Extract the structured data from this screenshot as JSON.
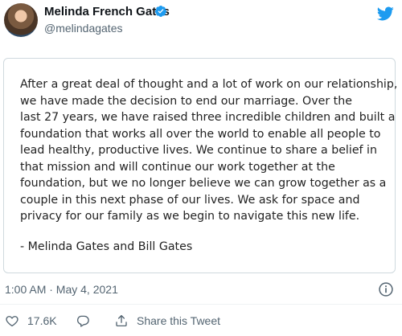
{
  "tweet": {
    "author": {
      "name": "Melinda French Gates",
      "handle": "@melindagates"
    },
    "statement_lines": [
      "After a great deal of thought and a lot of work on our relationship,",
      "we have made the decision to end our marriage. Over the",
      "last 27 years, we have raised three incredible children and built a",
      "foundation that works all over the world to enable all people to",
      "lead healthy, productive lives. We continue to share a belief in",
      "that mission and will continue our work together at the",
      "foundation, but we no longer believe we can grow together as a",
      "couple in this next phase of our lives. We ask for space and",
      "privacy for our family as we begin to navigate this new life."
    ],
    "signature": "- Melinda Gates and Bill Gates",
    "timestamp": "1:00 AM · May 4, 2021",
    "likes": "17.6K",
    "share_label": "Share this Tweet"
  },
  "icons": {
    "brand": "twitter-bird-icon",
    "verified": "verified-badge-icon",
    "info": "info-icon",
    "like": "heart-icon",
    "reply": "reply-icon",
    "share": "share-icon"
  },
  "colors": {
    "brand_blue": "#1d9bf0",
    "secondary_text": "#536471",
    "primary_text": "#0f1419",
    "card_border": "#cfd9de"
  }
}
